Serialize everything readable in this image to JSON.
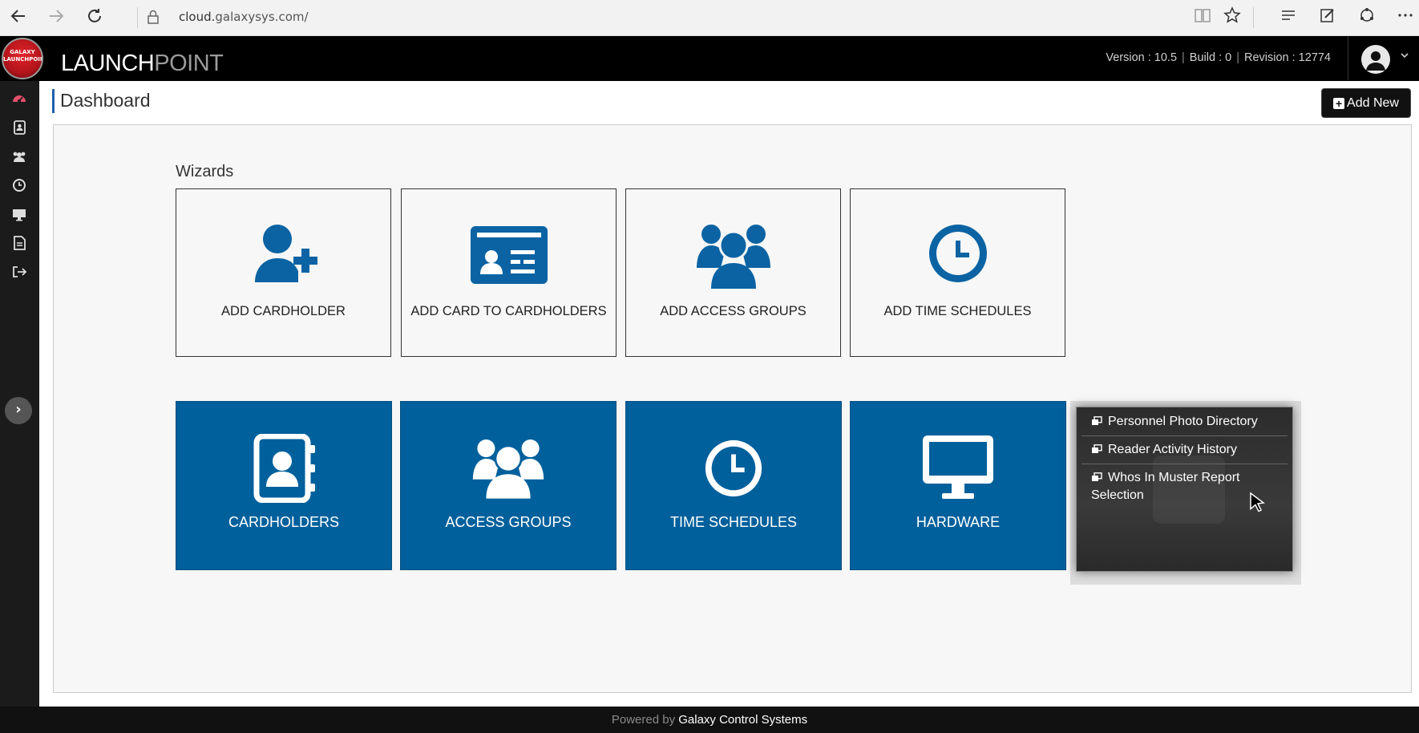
{
  "browser": {
    "url_prefix": "cloud.",
    "url_host": "galaxysys.com/"
  },
  "header": {
    "logo_text": "GALAXY LAUNCHPOINT",
    "brand_part1": "LAUNCH",
    "brand_part2": "POINT",
    "version_label": "Version : 10.5",
    "build_label": "Build : 0",
    "revision_label": "Revision : 12774",
    "separator": "|"
  },
  "sidebar": {
    "items": [
      {
        "name": "dashboard-icon",
        "active": true
      },
      {
        "name": "cardholders-icon"
      },
      {
        "name": "access-groups-icon"
      },
      {
        "name": "time-schedules-icon"
      },
      {
        "name": "hardware-icon"
      },
      {
        "name": "reports-icon"
      },
      {
        "name": "logout-icon"
      }
    ],
    "expand_glyph": "›"
  },
  "page": {
    "title": "Dashboard",
    "add_new_label": "Add New",
    "add_new_glyph": "+"
  },
  "wizards": {
    "section_title": "Wizards",
    "cards": [
      {
        "label": "ADD CARDHOLDER",
        "icon": "user-plus-icon"
      },
      {
        "label": "ADD CARD TO CARDHOLDERS",
        "icon": "id-card-icon"
      },
      {
        "label": "ADD ACCESS GROUPS",
        "icon": "users-icon"
      },
      {
        "label": "ADD TIME SCHEDULES",
        "icon": "clock-icon"
      }
    ]
  },
  "tiles": [
    {
      "label": "CARDHOLDERS",
      "icon": "address-book-icon"
    },
    {
      "label": "ACCESS GROUPS",
      "icon": "users-icon"
    },
    {
      "label": "TIME SCHEDULES",
      "icon": "clock-icon"
    },
    {
      "label": "HARDWARE",
      "icon": "desktop-icon"
    }
  ],
  "reports_menu": {
    "items": [
      {
        "label": "Personnel Photo Directory"
      },
      {
        "label": "Reader Activity History"
      },
      {
        "label": "Whos In Muster Report Selection"
      }
    ]
  },
  "footer": {
    "prefix": "Powered by",
    "company": "Galaxy Control Systems"
  },
  "colors": {
    "tile_blue": "#00609c",
    "wizard_icon_blue": "#0b63a3",
    "sidebar_active": "#e2506a",
    "header_bg": "#000000"
  }
}
